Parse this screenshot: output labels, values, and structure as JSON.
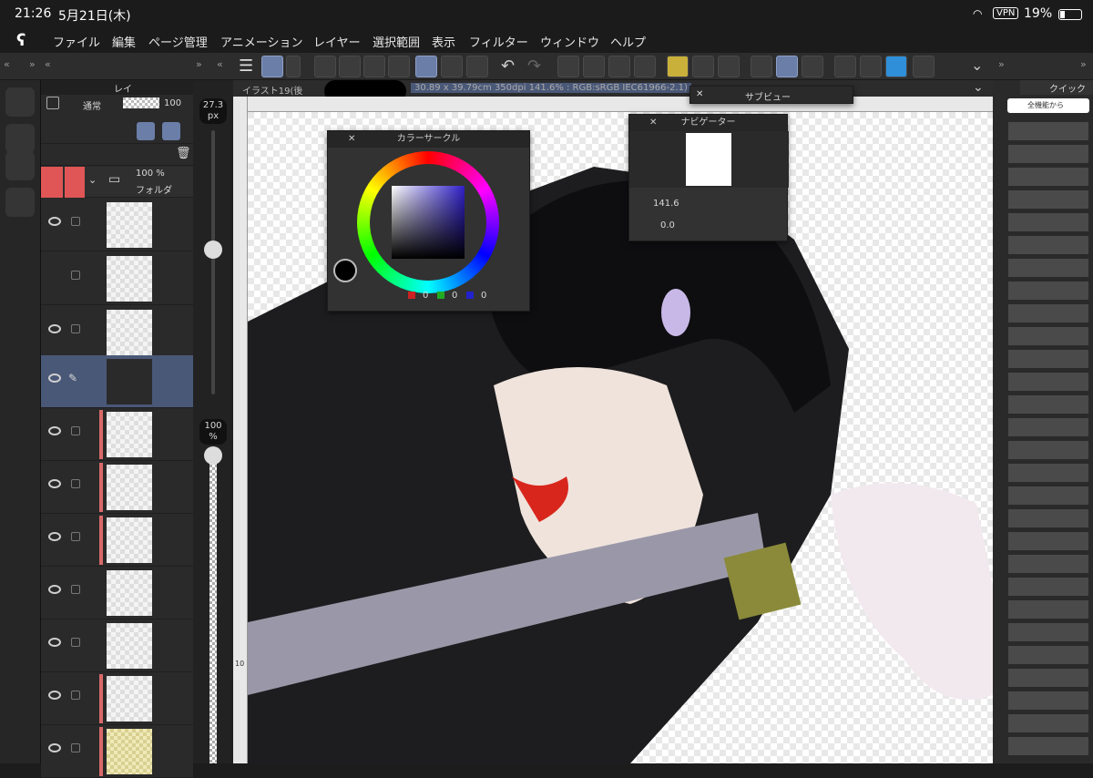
{
  "status": {
    "time": "21:26",
    "date": "5月21日(木)",
    "vpn": "VPN",
    "battery": "19%"
  },
  "menu": [
    "ファイル",
    "編集",
    "ページ管理",
    "アニメーション",
    "レイヤー",
    "選択範囲",
    "表示",
    "フィルター",
    "ウィンドウ",
    "ヘルプ"
  ],
  "layers_tab": "レイ",
  "blend": {
    "mode": "通常",
    "opacity": "100"
  },
  "folder": {
    "opacity": "100 %",
    "name": "フォルダ"
  },
  "brush": {
    "size": "27.3",
    "unit": "px",
    "opacity": "100",
    "opacity_unit": "%"
  },
  "document": {
    "title": "イラスト19(後",
    "info": "30.89 x 39.79cm 350dpi 141.6% : RGB:sRGB IEC61966-2.1)"
  },
  "subview": {
    "title": "サブビュー"
  },
  "color_circle": {
    "title": "カラーサークル",
    "r": "0",
    "g": "0",
    "b": "0"
  },
  "navigator": {
    "title": "ナビゲーター",
    "zoom": "141.6",
    "rotation": "0.0"
  },
  "quick": {
    "tab": "クイック",
    "search": "全機能から"
  },
  "ruler": {
    "mark": "10"
  },
  "colors": {
    "accent": "#6a7ea8",
    "selected_layer": "#4a5878",
    "red_tag": "#d96a6a"
  }
}
